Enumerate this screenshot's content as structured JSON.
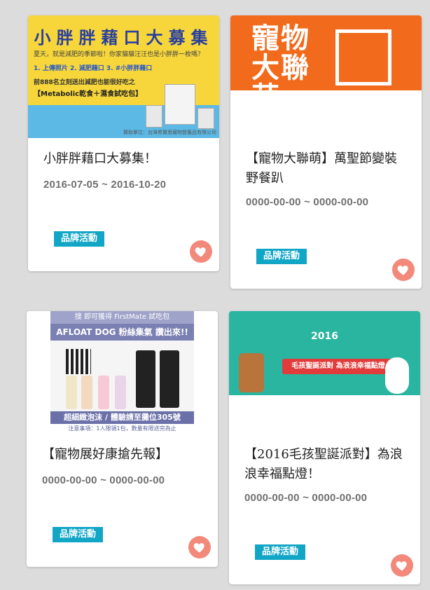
{
  "cards": [
    {
      "title": "小胖胖藉口大募集！",
      "dates": "2016-07-05 ~ 2016-10-20",
      "tag": "品牌活動",
      "banner": {
        "headline": "小胖胖藉口大募集",
        "subline": "夏天，就是減肥的季節啦！你家貓貓汪汪也是小胖胖一枚嗎？",
        "steps": "1. 上傳照片  2. 減肥藉口  3. #小胖胖藉口",
        "promo": "前888名立刻送出減肥也能很好吃之",
        "pack": "【Metabolic乾食＋濕食試吃包】",
        "footer": "贊助單位：台灣希爾思寵物營養品有限公司"
      }
    },
    {
      "title": "【寵物大聯萌】萬聖節變裝野餐趴",
      "dates": "0000-00-00 ~ 0000-00-00",
      "tag": "品牌活動",
      "banner": {
        "headline": "寵物大聯萌"
      }
    },
    {
      "title": "【寵物展好康搶先報】",
      "dates": "0000-00-00 ~ 0000-00-00",
      "tag": "品牌活動",
      "banner": {
        "top": "搜 即可獲得 FirstMate 試吃包",
        "bar": "AFLOAT DOG 粉絲集氣 讚出來!!",
        "bottom": "超細緻泡沫 / 體驗請至攤位305號",
        "note": "注意事項：1人限領1包，數量有限送完為止"
      }
    },
    {
      "title": "【2016毛孩聖誕派對】為浪浪幸福點燈！",
      "dates": "0000-00-00 ~ 0000-00-00",
      "tag": "品牌活動",
      "banner": {
        "year": "2016",
        "ribbon": "毛孩聖誕派對 為浪浪幸福點燈"
      }
    }
  ],
  "icons": {
    "favorite": "heart-icon"
  },
  "colors": {
    "tag": "#12a6c6",
    "heart": "#f2897a",
    "background": "#dcdcdc"
  }
}
